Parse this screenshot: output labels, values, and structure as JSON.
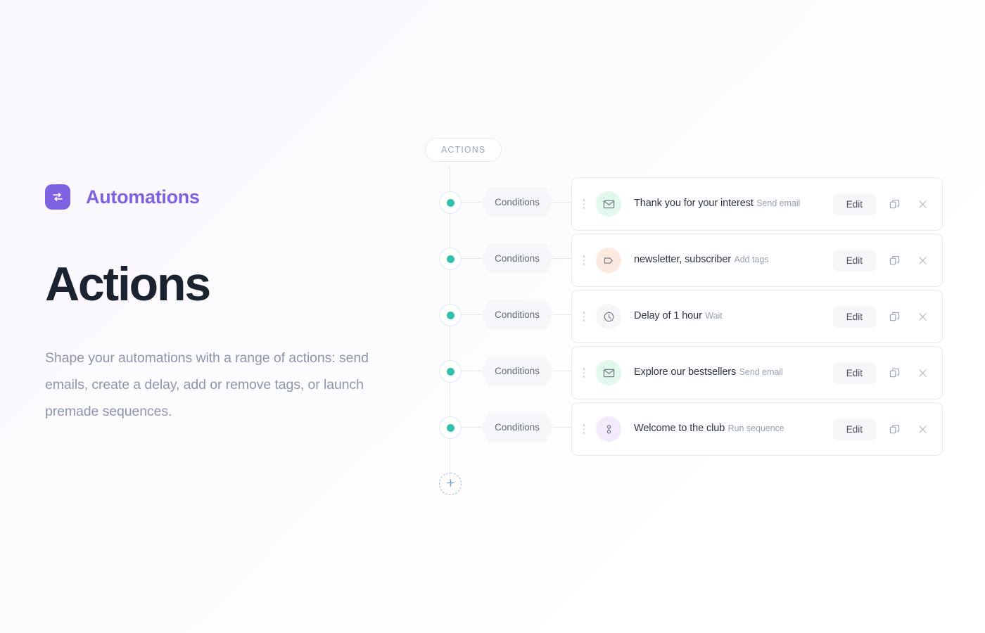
{
  "brand": {
    "name": "Automations",
    "logo_icon": "automation-loop-icon",
    "color": "#7f62e0"
  },
  "hero": {
    "title": "Actions",
    "description": "Shape your automations with a range of actions: send emails, create a delay, add or remove tags, or launch premade sequences."
  },
  "flow": {
    "badge_label": "ACTIONS",
    "condition_label": "Conditions",
    "node_color": "#2fc4a5",
    "add_button_label": "+",
    "add_button_icon": "plus-icon",
    "rows": [
      {
        "condition": "Conditions",
        "title": "Thank you for your interest",
        "subtitle": "Send email",
        "icon": "envelope-icon",
        "icon_bg": "#e1f8eb",
        "edit_label": "Edit",
        "duplicate_icon": "duplicate-icon",
        "close_icon": "close-icon"
      },
      {
        "condition": "Conditions",
        "title": "newsletter, subscriber",
        "subtitle": "Add tags",
        "icon": "tag-icon",
        "icon_bg": "#fdeade",
        "edit_label": "Edit",
        "duplicate_icon": "duplicate-icon",
        "close_icon": "close-icon"
      },
      {
        "condition": "Conditions",
        "title": "Delay of 1 hour",
        "subtitle": "Wait",
        "icon": "clock-icon",
        "icon_bg": "#f4f6f8",
        "edit_label": "Edit",
        "duplicate_icon": "duplicate-icon",
        "close_icon": "close-icon"
      },
      {
        "condition": "Conditions",
        "title": "Explore our bestsellers",
        "subtitle": "Send email",
        "icon": "envelope-icon",
        "icon_bg": "#e1f8eb",
        "edit_label": "Edit",
        "duplicate_icon": "duplicate-icon",
        "close_icon": "close-icon"
      },
      {
        "condition": "Conditions",
        "title": "Welcome to the club",
        "subtitle": "Run sequence",
        "icon": "sequence-icon",
        "icon_bg": "#f3ebfb",
        "edit_label": "Edit",
        "duplicate_icon": "duplicate-icon",
        "close_icon": "close-icon"
      }
    ]
  }
}
